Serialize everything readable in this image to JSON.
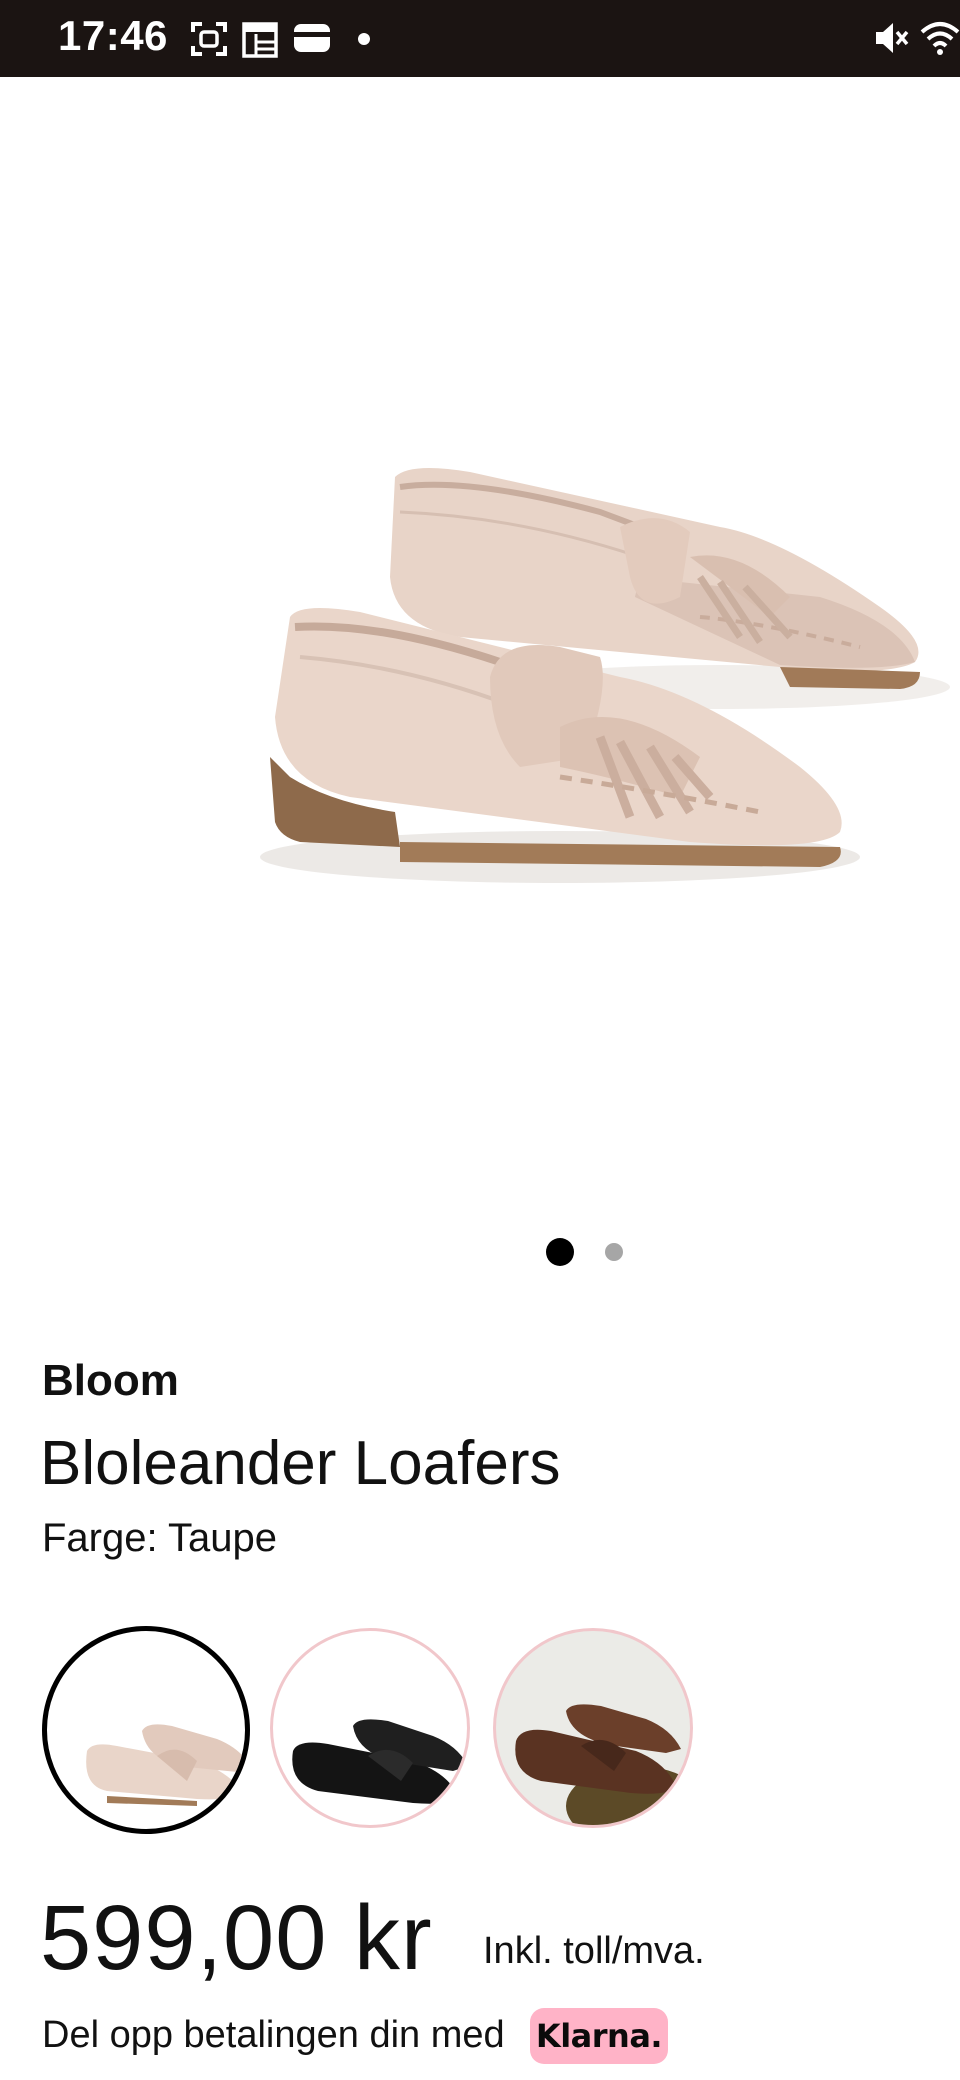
{
  "status_bar": {
    "time": "17:46",
    "icons": [
      "screenshot-icon",
      "calendar-icon",
      "wallet-icon",
      "notification-dot",
      "mute-icon",
      "wifi-icon"
    ]
  },
  "gallery": {
    "image_count": 2,
    "active_index": 0
  },
  "product": {
    "brand": "Bloom",
    "name": "Bloleander Loafers",
    "color_label": "Farge:",
    "color_value": "Taupe",
    "variants": [
      {
        "color": "Taupe",
        "selected": true
      },
      {
        "color": "Black",
        "selected": false
      },
      {
        "color": "Brown",
        "selected": false
      }
    ],
    "price": "599,00 kr",
    "price_note": "Inkl. toll/mva.",
    "installment_text": "Del opp betalingen din med",
    "klarna_label": "Klarna."
  },
  "colors": {
    "status_bar_bg": "#1b1412",
    "klarna_pink": "#ffb3c7",
    "swatch_border": "#f1c7cb"
  }
}
